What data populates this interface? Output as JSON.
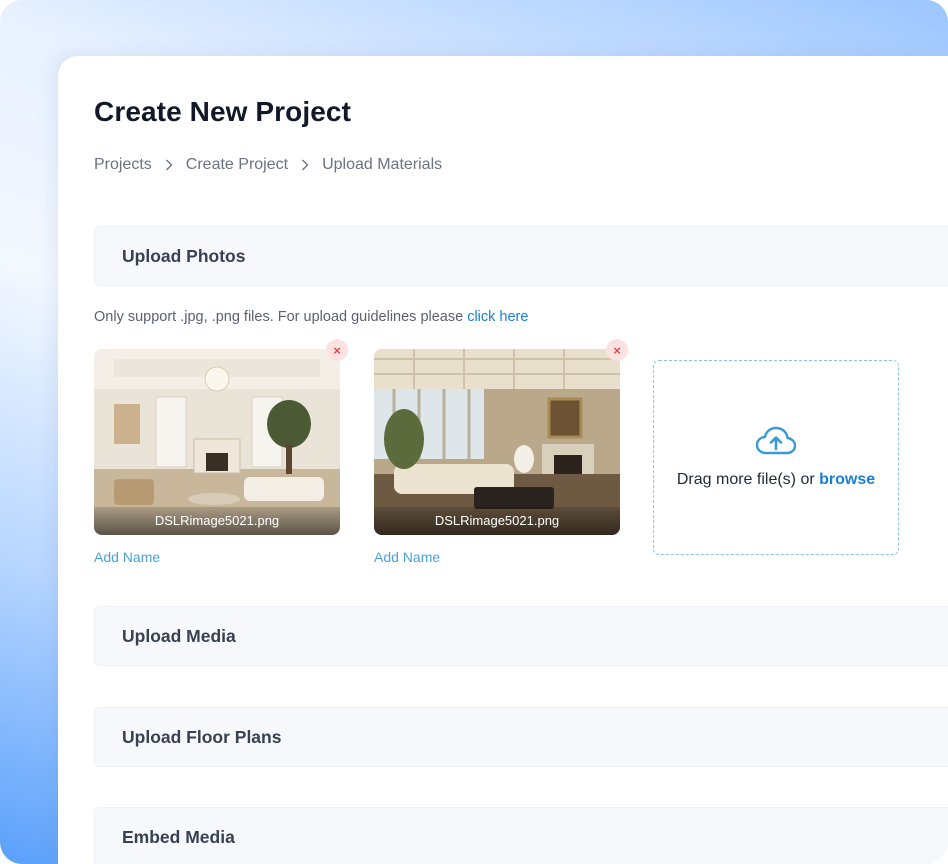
{
  "page": {
    "title": "Create New Project"
  },
  "breadcrumb": {
    "items": [
      "Projects",
      "Create Project",
      "Upload Materials"
    ]
  },
  "sections": {
    "photos": "Upload Photos",
    "media": "Upload Media",
    "floor_plans": "Upload Floor Plans",
    "embed": "Embed Media"
  },
  "upload_hint": {
    "text": "Only support .jpg, .png files. For upload guidelines please ",
    "link": "click here"
  },
  "photos": [
    {
      "filename": "DSLRimage5021.png",
      "add_name_label": "Add Name",
      "remove_label": "×"
    },
    {
      "filename": "DSLRimage5021.png",
      "add_name_label": "Add Name",
      "remove_label": "×"
    }
  ],
  "dropzone": {
    "text": "Drag more file(s) or ",
    "browse_label": "browse",
    "icon": "cloud-upload-icon"
  },
  "colors": {
    "accent": "#1a7fd3",
    "link_light": "#4aa3df",
    "remove_bg": "#fde2e2",
    "remove_fg": "#e5484d",
    "section_bg": "#f7f8fc"
  }
}
